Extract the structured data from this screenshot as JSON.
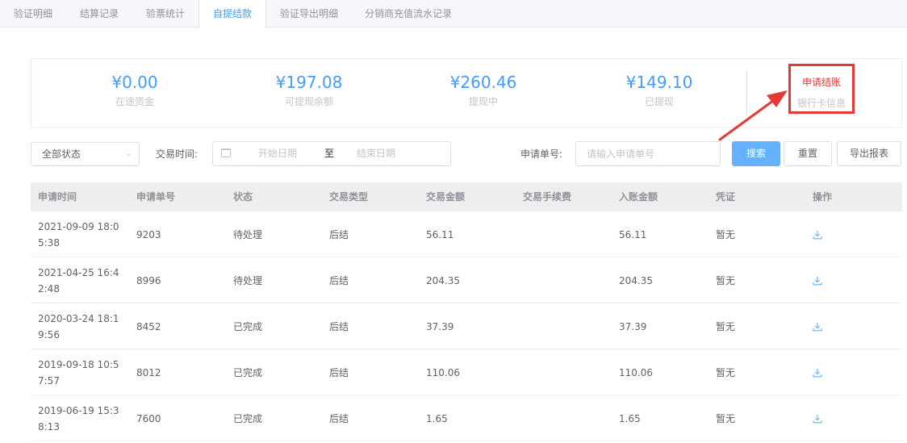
{
  "tabs": [
    {
      "label": "验证明细",
      "active": false
    },
    {
      "label": "结算记录",
      "active": false
    },
    {
      "label": "验票统计",
      "active": false
    },
    {
      "label": "自提结款",
      "active": true
    },
    {
      "label": "验证导出明细",
      "active": false
    },
    {
      "label": "分销商充值流水记录",
      "active": false
    }
  ],
  "summary": {
    "stats": [
      {
        "amount": "¥0.00",
        "label": "在途资金"
      },
      {
        "amount": "¥197.08",
        "label": "可提现余额"
      },
      {
        "amount": "¥260.46",
        "label": "提现中"
      },
      {
        "amount": "¥149.10",
        "label": "已提现"
      }
    ],
    "apply_label": "申请结账",
    "bank_label": "银行卡信息"
  },
  "filters": {
    "status_selected": "全部状态",
    "time_label": "交易时间:",
    "start_placeholder": "开始日期",
    "range_sep": "至",
    "end_placeholder": "结束日期",
    "order_label": "申请单号:",
    "order_placeholder": "请输入申请单号",
    "search_label": "搜索",
    "reset_label": "重置",
    "export_label": "导出报表"
  },
  "table": {
    "headers": [
      "申请时间",
      "申请单号",
      "状态",
      "交易类型",
      "交易金额",
      "交易手续费",
      "入账金额",
      "凭证",
      "操作"
    ],
    "rows": [
      {
        "time": "2021-09-09 18:05:38",
        "order": "9203",
        "status": "待处理",
        "type": "后结",
        "amount": "56.11",
        "fee": "",
        "credited": "56.11",
        "voucher": "暂无"
      },
      {
        "time": "2021-04-25 16:42:48",
        "order": "8996",
        "status": "待处理",
        "type": "后结",
        "amount": "204.35",
        "fee": "",
        "credited": "204.35",
        "voucher": "暂无"
      },
      {
        "time": "2020-03-24 18:19:56",
        "order": "8452",
        "status": "已完成",
        "type": "后结",
        "amount": "37.39",
        "fee": "",
        "credited": "37.39",
        "voucher": "暂无"
      },
      {
        "time": "2019-09-18 10:57:57",
        "order": "8012",
        "status": "已完成",
        "type": "后结",
        "amount": "110.06",
        "fee": "",
        "credited": "110.06",
        "voucher": "暂无"
      },
      {
        "time": "2019-06-19 15:38:13",
        "order": "7600",
        "status": "已完成",
        "type": "后结",
        "amount": "1.65",
        "fee": "",
        "credited": "1.65",
        "voucher": "暂无"
      }
    ]
  },
  "colors": {
    "accent": "#409eff",
    "highlight": "#e53935"
  },
  "icons": {
    "row_action": "download-icon",
    "date": "calendar-icon",
    "select": "chevron-down-icon"
  }
}
